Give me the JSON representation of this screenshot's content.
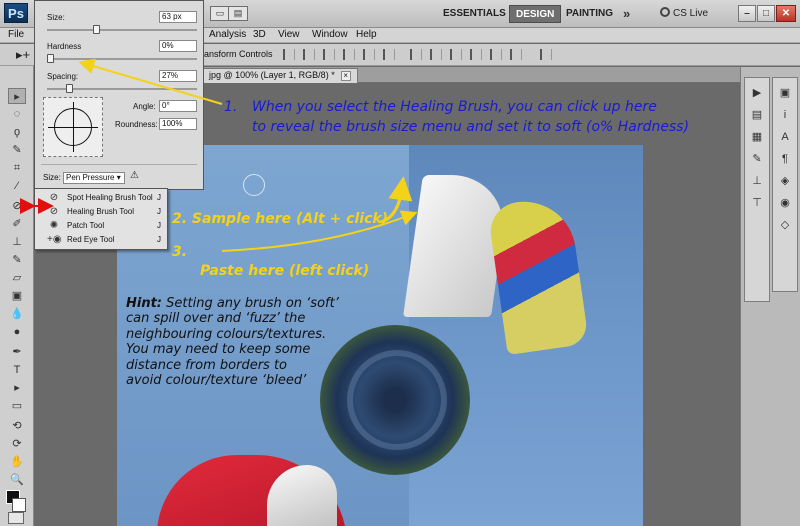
{
  "app": {
    "logo": "Ps",
    "workspaces": [
      "ESSENTIALS",
      "DESIGN",
      "PAINTING"
    ],
    "active_workspace": "DESIGN",
    "more": "»",
    "cs_live": "CS Live",
    "window_buttons": [
      "–",
      "□",
      "✕"
    ]
  },
  "menu": {
    "file": "File",
    "analysis": "Analysis",
    "threed": "3D",
    "view": "View",
    "window": "Window",
    "help": "Help"
  },
  "options": {
    "transform_controls": "ansform Controls"
  },
  "document_tab": {
    "label": "jpg @ 100% (Layer 1, RGB/8) *",
    "close": "×"
  },
  "brush_panel": {
    "size_label": "Size:",
    "size_value": "63 px",
    "hardness_label": "Hardness",
    "hardness_value": "0%",
    "spacing_label": "Spacing:",
    "spacing_value": "27%",
    "angle_label": "Angle:",
    "angle_value": "0°",
    "roundness_label": "Roundness:",
    "roundness_value": "100%",
    "size_control_label": "Size:",
    "size_control_value": "Pen Pressure",
    "size_fraction": 0.32,
    "hardness_fraction": 0.0,
    "spacing_fraction": 0.13
  },
  "tool_flyout": {
    "items": [
      {
        "label": "Spot Healing Brush Tool",
        "key": "J",
        "icon": "spot-healing-icon"
      },
      {
        "label": "Healing Brush Tool",
        "key": "J",
        "icon": "healing-brush-icon"
      },
      {
        "label": "Patch Tool",
        "key": "J",
        "icon": "patch-icon"
      },
      {
        "label": "Red Eye Tool",
        "key": "J",
        "icon": "red-eye-icon"
      }
    ]
  },
  "annotations": {
    "step1_num": "1.",
    "step1_line1": "When you select the Healing Brush, you can click up here",
    "step1_line2": "to reveal the brush size menu and set it to soft (o% Hardness)",
    "step2": "2.  Sample here (Alt + click)",
    "step3_num": "3.",
    "step3": "Paste here (left click)",
    "hint_title": "Hint:",
    "hint_line1": " Setting any brush on ‘soft’",
    "hint_line2": "can spill over and ‘fuzz’ the",
    "hint_line3": "neighbouring colours/textures.",
    "hint_line4": "You may need to keep some",
    "hint_line5": "distance from borders to",
    "hint_line6": "avoid colour/texture ‘bleed’"
  },
  "colors": {
    "note_blue": "#1a1ad4",
    "note_yellow": "#f4d21a",
    "arrow_red": "#e01010"
  }
}
